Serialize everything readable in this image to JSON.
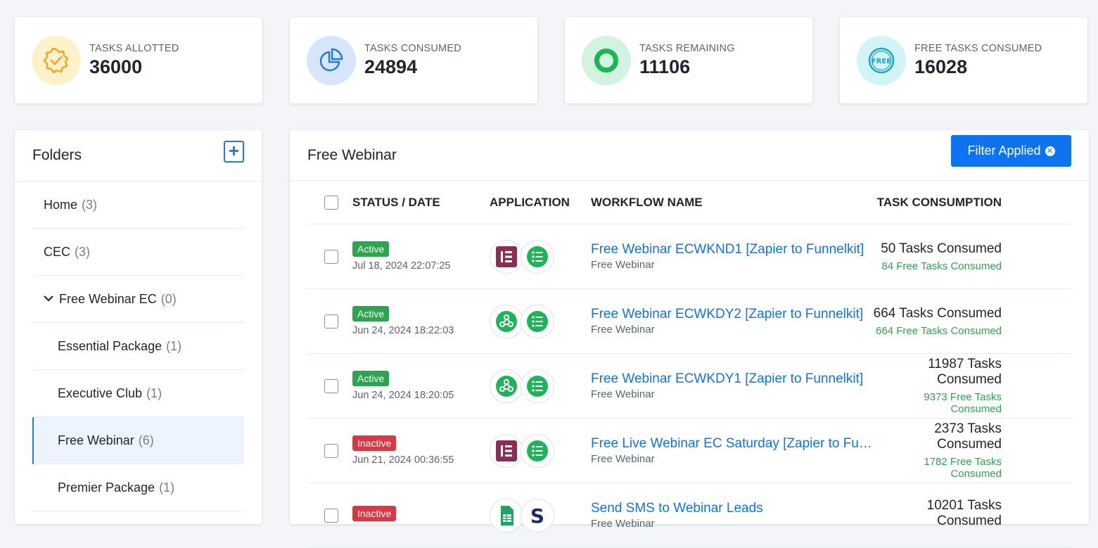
{
  "stats": [
    {
      "label": "TASKS ALLOTTED",
      "value": "36000",
      "icon": "badge-check-icon",
      "bg": "#fff1c9",
      "fg": "#f5a623"
    },
    {
      "label": "TASKS CONSUMED",
      "value": "24894",
      "icon": "pie-chart-icon",
      "bg": "#d6e6fc",
      "fg": "#1e7be8"
    },
    {
      "label": "TASKS REMAINING",
      "value": "11106",
      "icon": "donut-icon",
      "bg": "#d2f3e0",
      "fg": "#1fb35a"
    },
    {
      "label": "FREE TASKS CONSUMED",
      "value": "16028",
      "icon": "free-badge-icon",
      "bg": "#d2f3f7",
      "fg": "#17a7c4"
    }
  ],
  "folders": {
    "title": "Folders",
    "add_label": "+",
    "items": [
      {
        "name": "Home",
        "count": "(3)"
      },
      {
        "name": "CEC",
        "count": "(3)"
      },
      {
        "name": "Free Webinar EC",
        "count": "(0)"
      },
      {
        "name": "Essential Package",
        "count": "(1)"
      },
      {
        "name": "Executive Club",
        "count": "(1)"
      },
      {
        "name": "Free Webinar",
        "count": "(6)"
      },
      {
        "name": "Premier Package",
        "count": "(1)"
      }
    ]
  },
  "main": {
    "title": "Free Webinar",
    "filter_label": "Filter Applied",
    "columns": [
      "STATUS / DATE",
      "APPLICATION",
      "WORKFLOW NAME",
      "TASK CONSUMPTION"
    ],
    "rows": [
      {
        "status": "Active",
        "date": "Jul 18, 2024 22:07:25",
        "apps": [
          "elementor-icon",
          "list-icon"
        ],
        "name": "Free Webinar ECWKND1 [Zapier to Funnelkit]",
        "folder": "Free Webinar",
        "tasks": "50 Tasks Consumed",
        "free": "84 Free Tasks Consumed"
      },
      {
        "status": "Active",
        "date": "Jun 24, 2024 18:22:03",
        "apps": [
          "webhook-icon",
          "list-icon"
        ],
        "name": "Free Webinar ECWKDY2 [Zapier to Funnelkit]",
        "folder": "Free Webinar",
        "tasks": "664 Tasks Consumed",
        "free": "664 Free Tasks Consumed"
      },
      {
        "status": "Active",
        "date": "Jun 24, 2024 18:20:05",
        "apps": [
          "webhook-icon",
          "list-icon"
        ],
        "name": "Free Webinar ECWKDY1 [Zapier to Funnelkit]",
        "folder": "Free Webinar",
        "tasks": "11987 Tasks Consumed",
        "free": "9373 Free Tasks Consumed"
      },
      {
        "status": "Inactive",
        "date": "Jun 21, 2024 00:36:55",
        "apps": [
          "elementor-icon",
          "list-icon"
        ],
        "name": "Free Live Webinar EC Saturday [Zapier to Funnelkit]",
        "folder": "Free Webinar",
        "tasks": "2373 Tasks Consumed",
        "free": "1782 Free Tasks Consumed"
      },
      {
        "status": "Inactive",
        "date": "",
        "apps": [
          "sheets-icon",
          "s-icon"
        ],
        "name": "Send SMS to Webinar Leads",
        "folder": "Free Webinar",
        "tasks": "10201 Tasks Consumed",
        "free": ""
      }
    ]
  }
}
